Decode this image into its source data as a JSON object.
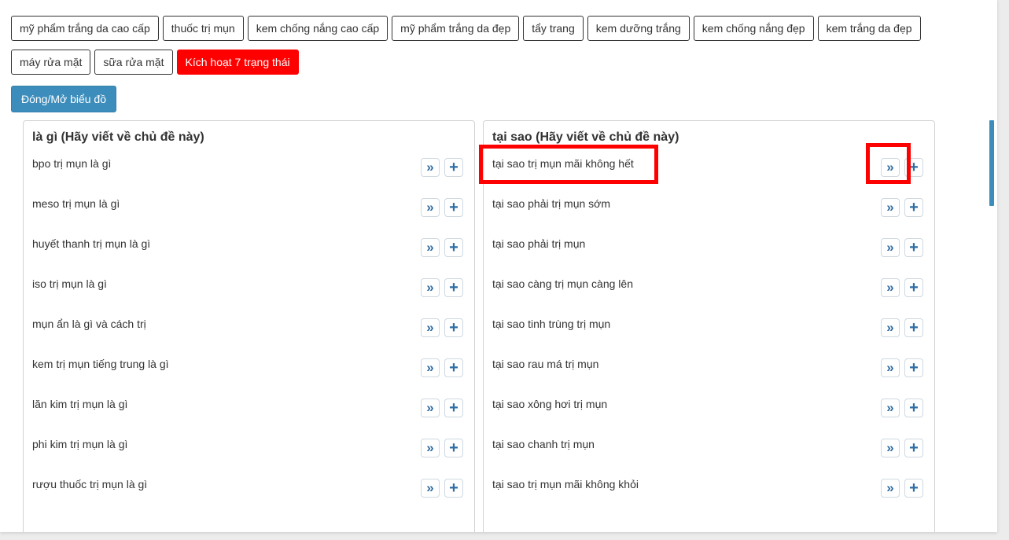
{
  "tags": [
    "mỹ phẩm trắng da cao cấp",
    "thuốc trị mụn",
    "kem chống nắng cao cấp",
    "mỹ phẩm trắng da đẹp",
    "tẩy trang",
    "kem dưỡng trắng",
    "kem chống nắng đẹp",
    "kem trắng da đẹp",
    "máy rửa mặt",
    "sữa rửa mặt"
  ],
  "active_tag": "Kích hoạt 7 trạng thái",
  "toggle_label": "Đóng/Mở biểu đồ",
  "icons": {
    "next": "»",
    "add": "+"
  },
  "colors": {
    "accent": "#3c8dbc",
    "highlight": "#ff0000",
    "active_tag": "#ff0000"
  },
  "panels": [
    {
      "title": "là gì (Hãy viết về chủ đề này)",
      "items": [
        "bpo trị mụn là gì",
        "meso trị mụn là gì",
        "huyết thanh trị mụn là gì",
        "iso trị mụn là gì",
        "mụn ẩn là gì và cách trị",
        "kem trị mụn tiếng trung là gì",
        "lăn kim trị mụn là gì",
        "phi kim trị mụn là gì",
        "rượu thuốc trị mụn là gì"
      ]
    },
    {
      "title": "tại sao (Hãy viết về chủ đề này)",
      "items": [
        "tại sao trị mụn mãi không hết",
        "tại sao phải trị mụn sớm",
        "tại sao phải trị mụn",
        "tại sao càng trị mụn càng lên",
        "tại sao tinh trùng trị mụn",
        "tại sao rau má trị mụn",
        "tại sao xông hơi trị mụn",
        "tại sao chanh trị mụn",
        "tại sao trị mụn mãi không khỏi"
      ]
    }
  ]
}
